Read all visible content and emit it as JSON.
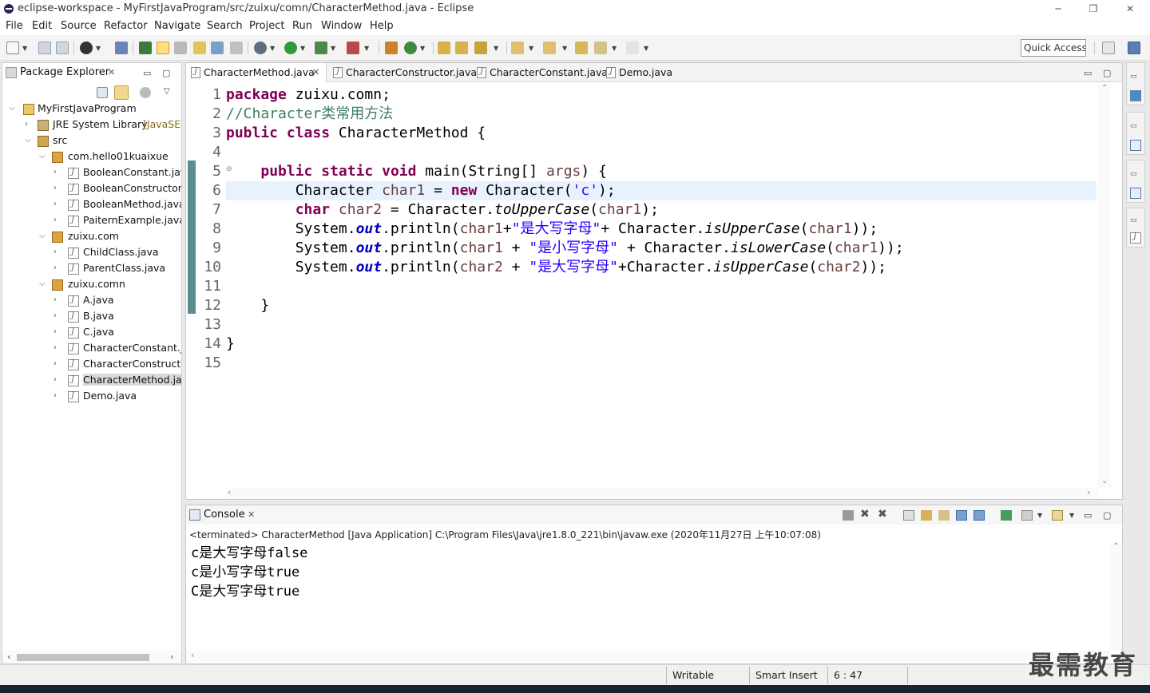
{
  "window": {
    "title": "eclipse-workspace - MyFirstJavaProgram/src/zuixu/comn/CharacterMethod.java - Eclipse",
    "minimize": "─",
    "restore": "❐",
    "close": "✕"
  },
  "menu": [
    "File",
    "Edit",
    "Source",
    "Refactor",
    "Navigate",
    "Search",
    "Project",
    "Run",
    "Window",
    "Help"
  ],
  "toolbar": {
    "quick_access": "Quick Access"
  },
  "package_explorer": {
    "title": "Package Explorer",
    "close": "✕",
    "tree": [
      {
        "label": "MyFirstJavaProgram",
        "level": 0,
        "expanded": true,
        "icon": "project-icon"
      },
      {
        "label": "JRE System Library",
        "suffix": "[JavaSE-",
        "level": 1,
        "expanded": false,
        "icon": "library-icon"
      },
      {
        "label": "src",
        "level": 1,
        "expanded": true,
        "icon": "source-folder-icon"
      },
      {
        "label": "com.hello01kuaixue",
        "level": 2,
        "expanded": true,
        "icon": "package-icon"
      },
      {
        "label": "BooleanConstant.java",
        "level": 3,
        "icon": "java-file-icon"
      },
      {
        "label": "BooleanConstructor.j",
        "level": 3,
        "icon": "java-file-icon"
      },
      {
        "label": "BooleanMethod.java",
        "level": 3,
        "icon": "java-file-icon"
      },
      {
        "label": "PaiternExample.java",
        "level": 3,
        "icon": "java-file-icon"
      },
      {
        "label": "zuixu.com",
        "level": 2,
        "expanded": true,
        "icon": "package-icon"
      },
      {
        "label": "ChildClass.java",
        "level": 3,
        "icon": "java-file-icon"
      },
      {
        "label": "ParentClass.java",
        "level": 3,
        "icon": "java-file-icon"
      },
      {
        "label": "zuixu.comn",
        "level": 2,
        "expanded": true,
        "icon": "package-icon"
      },
      {
        "label": "A.java",
        "level": 3,
        "icon": "java-file-icon"
      },
      {
        "label": "B.java",
        "level": 3,
        "icon": "java-file-icon"
      },
      {
        "label": "C.java",
        "level": 3,
        "icon": "java-file-icon"
      },
      {
        "label": "CharacterConstant.ja",
        "level": 3,
        "icon": "java-file-icon"
      },
      {
        "label": "CharacterConstructor",
        "level": 3,
        "icon": "java-file-icon"
      },
      {
        "label": "CharacterMethod.jav",
        "level": 3,
        "icon": "java-file-icon",
        "selected": true
      },
      {
        "label": "Demo.java",
        "level": 3,
        "icon": "java-file-icon"
      }
    ]
  },
  "editor": {
    "tabs": [
      {
        "label": "CharacterMethod.java",
        "active": true,
        "close": "✕"
      },
      {
        "label": "CharacterConstructor.java"
      },
      {
        "label": "CharacterConstant.java"
      },
      {
        "label": "Demo.java"
      }
    ],
    "line_numbers": [
      "1",
      "2",
      "3",
      "4",
      "5",
      "6",
      "7",
      "8",
      "9",
      "10",
      "11",
      "12",
      "13",
      "14",
      "15"
    ],
    "current_line": 6,
    "code": [
      [
        {
          "t": "package",
          "c": "kw"
        },
        {
          "t": " zuixu.comn;"
        }
      ],
      [
        {
          "t": "//Character类常用方法",
          "c": "cm"
        }
      ],
      [
        {
          "t": "public",
          "c": "kw"
        },
        {
          "t": " "
        },
        {
          "t": "class",
          "c": "kw"
        },
        {
          "t": " CharacterMethod {"
        }
      ],
      [
        {
          "t": ""
        }
      ],
      [
        {
          "t": "    "
        },
        {
          "t": "public",
          "c": "kw"
        },
        {
          "t": " "
        },
        {
          "t": "static",
          "c": "kw"
        },
        {
          "t": " "
        },
        {
          "t": "void",
          "c": "kw"
        },
        {
          "t": " main(String[] "
        },
        {
          "t": "args",
          "c": "var"
        },
        {
          "t": ") {"
        }
      ],
      [
        {
          "t": "        Character "
        },
        {
          "t": "char1",
          "c": "var"
        },
        {
          "t": " = "
        },
        {
          "t": "new",
          "c": "kw"
        },
        {
          "t": " Character("
        },
        {
          "t": "'c'",
          "c": "st"
        },
        {
          "t": ");"
        }
      ],
      [
        {
          "t": "        "
        },
        {
          "t": "char",
          "c": "kw"
        },
        {
          "t": " "
        },
        {
          "t": "char2",
          "c": "var"
        },
        {
          "t": " = Character."
        },
        {
          "t": "toUpperCase",
          "c": "sm"
        },
        {
          "t": "("
        },
        {
          "t": "char1",
          "c": "var"
        },
        {
          "t": ");"
        }
      ],
      [
        {
          "t": "        System."
        },
        {
          "t": "out",
          "c": "fld"
        },
        {
          "t": ".println("
        },
        {
          "t": "char1",
          "c": "var"
        },
        {
          "t": "+"
        },
        {
          "t": "\"是大写字母\"",
          "c": "st"
        },
        {
          "t": "+ Character."
        },
        {
          "t": "isUpperCase",
          "c": "sm"
        },
        {
          "t": "("
        },
        {
          "t": "char1",
          "c": "var"
        },
        {
          "t": "));"
        }
      ],
      [
        {
          "t": "        System."
        },
        {
          "t": "out",
          "c": "fld"
        },
        {
          "t": ".println("
        },
        {
          "t": "char1",
          "c": "var"
        },
        {
          "t": " + "
        },
        {
          "t": "\"是小写字母\"",
          "c": "st"
        },
        {
          "t": " + Character."
        },
        {
          "t": "isLowerCase",
          "c": "sm"
        },
        {
          "t": "("
        },
        {
          "t": "char1",
          "c": "var"
        },
        {
          "t": "));"
        }
      ],
      [
        {
          "t": "        System."
        },
        {
          "t": "out",
          "c": "fld"
        },
        {
          "t": ".println("
        },
        {
          "t": "char2",
          "c": "var"
        },
        {
          "t": " + "
        },
        {
          "t": "\"是大写字母\"",
          "c": "st"
        },
        {
          "t": "+Character."
        },
        {
          "t": "isUpperCase",
          "c": "sm"
        },
        {
          "t": "("
        },
        {
          "t": "char2",
          "c": "var"
        },
        {
          "t": "));"
        }
      ],
      [
        {
          "t": ""
        }
      ],
      [
        {
          "t": "    }"
        }
      ],
      [
        {
          "t": ""
        }
      ],
      [
        {
          "t": "}"
        }
      ],
      [
        {
          "t": ""
        }
      ]
    ]
  },
  "console": {
    "title": "Console",
    "close": "✕",
    "description": "<terminated> CharacterMethod [Java Application] C:\\Program Files\\Java\\jre1.8.0_221\\bin\\javaw.exe (2020年11月27日 上午10:07:08)",
    "output": [
      "c是大写字母false",
      "c是小写字母true",
      "C是大写字母true"
    ]
  },
  "status": {
    "writable": "Writable",
    "insert_mode": "Smart Insert",
    "position": "6 : 47"
  },
  "watermark": "最需教育",
  "colors": {
    "keyword": "#7f0055",
    "comment": "#3f7f5f",
    "string": "#2a00ff",
    "field": "#0000c0",
    "variable": "#6a3e3e",
    "current_line": "#e8f2fe"
  }
}
